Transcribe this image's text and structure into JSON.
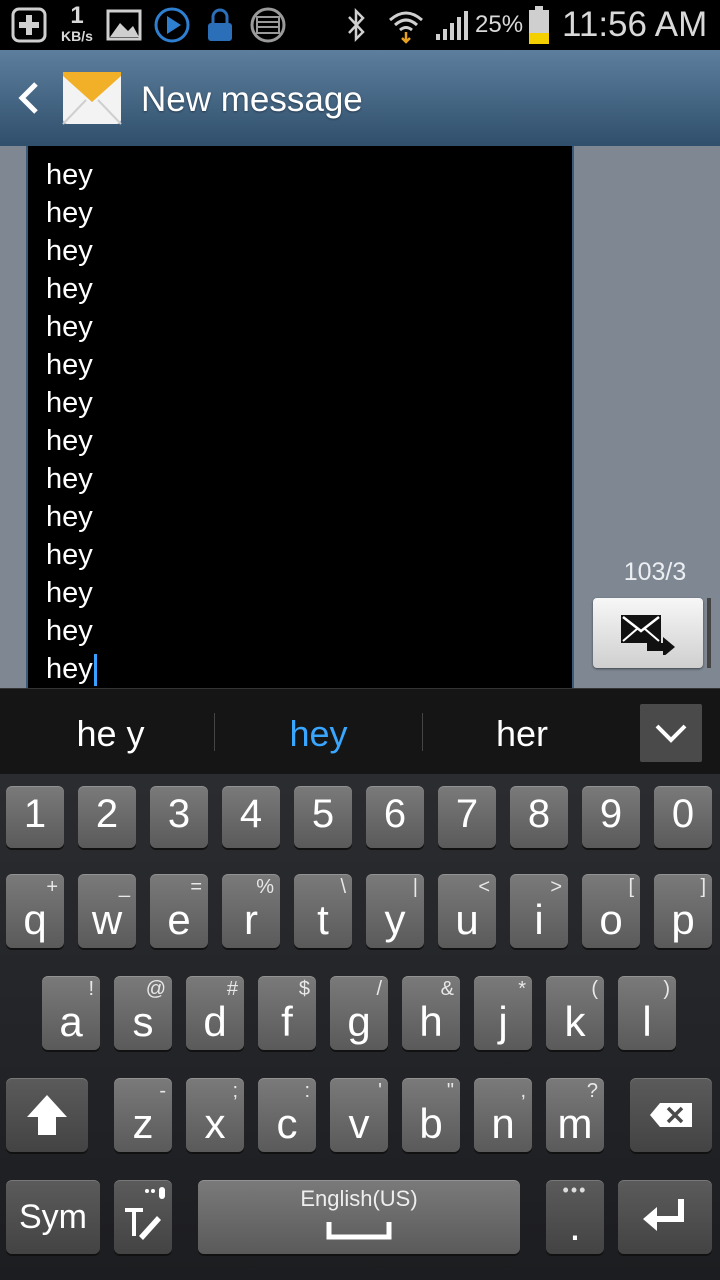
{
  "status_bar": {
    "data_rate": "1",
    "data_unit": "KB/s",
    "battery": "25%",
    "time": "11:56 AM",
    "icons": [
      "add-icon",
      "kbs-indicator",
      "image-icon",
      "play-icon",
      "lock-icon",
      "storage-icon",
      "bluetooth-icon",
      "wifi-icon",
      "signal-icon",
      "battery-icon"
    ]
  },
  "header": {
    "title": "New message",
    "back_icon": "back-arrow-icon",
    "app_icon": "envelope-icon"
  },
  "message": {
    "lines": [
      "hey",
      "hey",
      "hey",
      "hey",
      "hey",
      "hey",
      "hey",
      "hey",
      "hey",
      "hey",
      "hey",
      "hey",
      "hey",
      "hey"
    ],
    "counter": "103/3",
    "send_icon": "send-mms-icon"
  },
  "suggestions": {
    "left": "he y",
    "center": "hey",
    "right": "her",
    "collapse_icon": "chevron-down-icon"
  },
  "keyboard": {
    "numbers": [
      "1",
      "2",
      "3",
      "4",
      "5",
      "6",
      "7",
      "8",
      "9",
      "0"
    ],
    "row1": [
      {
        "key": "q",
        "alt": "+"
      },
      {
        "key": "w",
        "alt": "_"
      },
      {
        "key": "e",
        "alt": "="
      },
      {
        "key": "r",
        "alt": "%"
      },
      {
        "key": "t",
        "alt": "\\"
      },
      {
        "key": "y",
        "alt": "|"
      },
      {
        "key": "u",
        "alt": "<"
      },
      {
        "key": "i",
        "alt": ">"
      },
      {
        "key": "o",
        "alt": "["
      },
      {
        "key": "p",
        "alt": "]"
      }
    ],
    "row2": [
      {
        "key": "a",
        "alt": "!"
      },
      {
        "key": "s",
        "alt": "@"
      },
      {
        "key": "d",
        "alt": "#"
      },
      {
        "key": "f",
        "alt": "$"
      },
      {
        "key": "g",
        "alt": "/"
      },
      {
        "key": "h",
        "alt": "&"
      },
      {
        "key": "j",
        "alt": "*"
      },
      {
        "key": "k",
        "alt": "("
      },
      {
        "key": "l",
        "alt": ")"
      }
    ],
    "row3": [
      {
        "key": "z",
        "alt": "-"
      },
      {
        "key": "x",
        "alt": ";"
      },
      {
        "key": "c",
        "alt": ":"
      },
      {
        "key": "v",
        "alt": "'"
      },
      {
        "key": "b",
        "alt": "\""
      },
      {
        "key": "n",
        "alt": ","
      },
      {
        "key": "m",
        "alt": "?"
      }
    ],
    "sym": "Sym",
    "language": "English(US)",
    "period": ".",
    "accent_color": "#39a6ff"
  }
}
